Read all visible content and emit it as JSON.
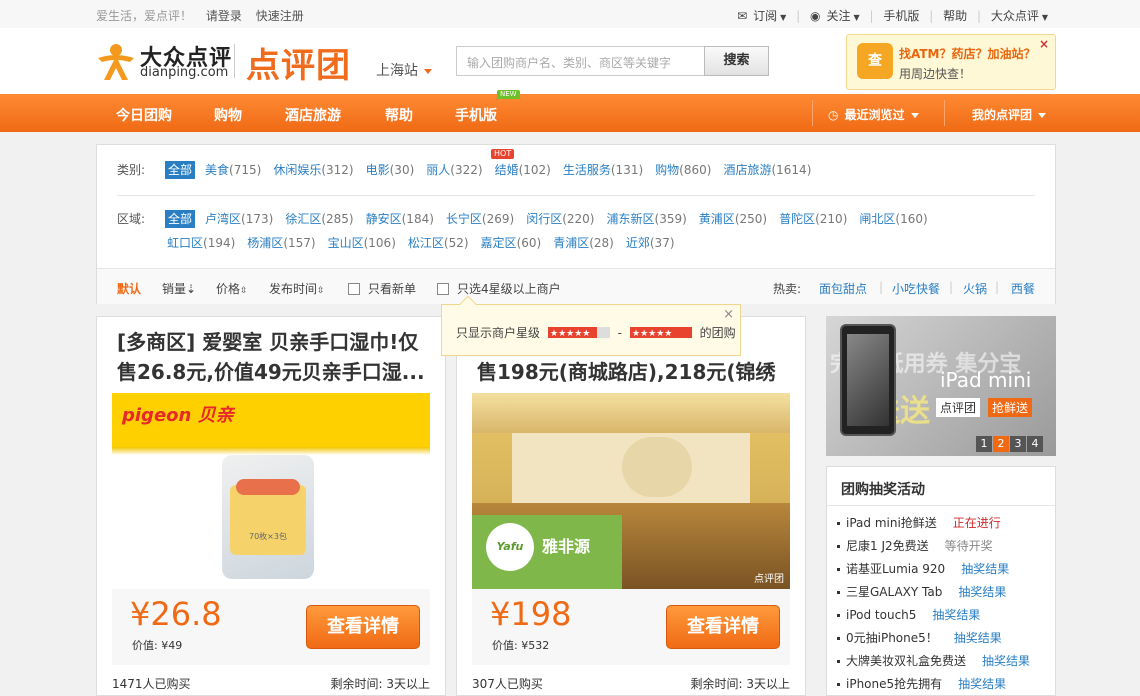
{
  "topbar": {
    "slogan": "爱生活，爱点评！",
    "login": "请登录",
    "register": "快速注册",
    "subscribe": "订阅",
    "follow": "关注",
    "mobile": "手机版",
    "help": "帮助",
    "dianping": "大众点评"
  },
  "header": {
    "logo_cn": "大众点评",
    "logo_en": "dianping.com",
    "logo_tuan": "点评团",
    "city": "上海站",
    "search_placeholder": "输入团购商户名、类别、商区等关键字",
    "search_button": "搜索",
    "promo_title": "找ATM？药店？加油站？",
    "promo_sub": "用周边快查！",
    "promo_close": "×",
    "promo_icon": "查"
  },
  "nav": {
    "items": [
      "今日团购",
      "购物",
      "酒店旅游",
      "帮助",
      "手机版"
    ],
    "new_badge": "NEW",
    "recent": "最近浏览过",
    "my": "我的点评团"
  },
  "filter": {
    "category_label": "类别:",
    "all": "全部",
    "categories": [
      {
        "name": "美食",
        "count": "(715)"
      },
      {
        "name": "休闲娱乐",
        "count": "(312)"
      },
      {
        "name": "电影",
        "count": "(30)"
      },
      {
        "name": "丽人",
        "count": "(322)"
      },
      {
        "name": "结婚",
        "count": "(102)"
      },
      {
        "name": "生活服务",
        "count": "(131)"
      },
      {
        "name": "购物",
        "count": "(860)"
      },
      {
        "name": "酒店旅游",
        "count": "(1614)"
      }
    ],
    "hot_badge": "HOT",
    "district_label": "区域:",
    "districts_row1": [
      {
        "name": "卢湾区",
        "count": "(173)"
      },
      {
        "name": "徐汇区",
        "count": "(285)"
      },
      {
        "name": "静安区",
        "count": "(184)"
      },
      {
        "name": "长宁区",
        "count": "(269)"
      },
      {
        "name": "闵行区",
        "count": "(220)"
      },
      {
        "name": "浦东新区",
        "count": "(359)"
      },
      {
        "name": "黄浦区",
        "count": "(250)"
      },
      {
        "name": "普陀区",
        "count": "(210)"
      },
      {
        "name": "闸北区",
        "count": "(160)"
      }
    ],
    "districts_row2": [
      {
        "name": "虹口区",
        "count": "(194)"
      },
      {
        "name": "杨浦区",
        "count": "(157)"
      },
      {
        "name": "宝山区",
        "count": "(106)"
      },
      {
        "name": "松江区",
        "count": "(52)"
      },
      {
        "name": "嘉定区",
        "count": "(60)"
      },
      {
        "name": "青浦区",
        "count": "(28)"
      },
      {
        "name": "近郊",
        "count": "(37)"
      }
    ]
  },
  "sort": {
    "default": "默认",
    "sales": "销量",
    "price": "价格",
    "time": "发布时间",
    "new_only": "只看新单",
    "four_star": "只选4星级以上商户",
    "hot_label": "热卖:",
    "hot_items": [
      "面包甜点",
      "小吃快餐",
      "火锅",
      "西餐"
    ]
  },
  "tooltip": {
    "prefix": "只显示商户星级",
    "dash": "-",
    "suffix": "的团购",
    "close": "×"
  },
  "deals": [
    {
      "title": "[多商区] 爱婴室 贝亲手口湿巾!仅售26.8元,价值49元贝亲手口湿...",
      "brand": "pigeon 贝亲",
      "pack_text": "70枚×3包",
      "price": "¥26.8",
      "value": "价值: ¥49",
      "button": "查看详情",
      "bought": "1471人已购买",
      "remaining": "剩余时间:  3天以上"
    },
    {
      "title": "售198元(商城路店),218元(锦绣坊",
      "brand": "雅非源",
      "logo_text": "Yafu",
      "watermark": "点评团",
      "price": "¥198",
      "value": "价值: ¥532",
      "button": "查看详情",
      "bought": "307人已购买",
      "remaining": "剩余时间:  3天以上"
    }
  ],
  "banner": {
    "product": "iPad mini",
    "brand": "点评团",
    "tag": "抢鲜送",
    "bg_text": "完美 抵用券 集分宝",
    "bg_text2": "送送送",
    "pages": [
      "1",
      "2",
      "3",
      "4"
    ]
  },
  "lottery": {
    "title": "团购抽奖活动",
    "items": [
      {
        "name": "iPad mini抢鲜送",
        "status": "正在进行",
        "state": "on"
      },
      {
        "name": "尼康1 J2免费送",
        "status": "等待开奖",
        "state": "wait"
      },
      {
        "name": "诺基亚Lumia 920",
        "status": "抽奖结果",
        "state": "done"
      },
      {
        "name": "三星GALAXY Tab",
        "status": "抽奖结果",
        "state": "done"
      },
      {
        "name": "iPod touch5",
        "status": "抽奖结果",
        "state": "done"
      },
      {
        "name": "0元抽iPhone5！",
        "status": "抽奖结果",
        "state": "done"
      },
      {
        "name": "大牌美妆双礼盒免费送",
        "status": "抽奖结果",
        "state": "done"
      },
      {
        "name": "iPhone5抢先拥有",
        "status": "抽奖结果",
        "state": "done"
      }
    ]
  },
  "colors": {
    "brand_orange": "#f06a15",
    "link_blue": "#2a7fc4",
    "topbar_bg": "#f7f7f7"
  }
}
